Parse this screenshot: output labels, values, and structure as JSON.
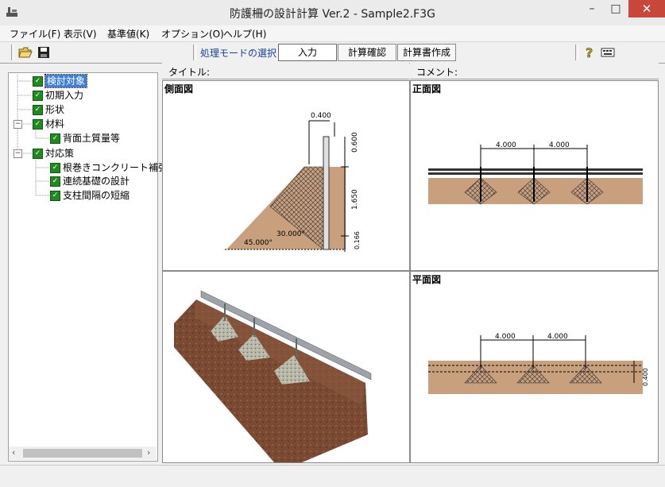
{
  "window": {
    "title": "防護柵の設計計算 Ver.2 - Sample2.F3G",
    "minimize_glyph": "–",
    "maximize_glyph": "□",
    "close_glyph": "✕"
  },
  "menu": [
    {
      "label": "ファイル(F)"
    },
    {
      "label": "表示(V)"
    },
    {
      "label": "基準値(K)"
    },
    {
      "label": "オプション(O)"
    },
    {
      "label": "ヘルプ(H)"
    }
  ],
  "toolbar": {
    "icons": [
      "open-folder-icon",
      "save-disk-icon",
      "help-icon",
      "keyboard-icon"
    ],
    "mode_label": "処理モードの選択",
    "mode_buttons": [
      "入力",
      "計算確認",
      "計算書作成"
    ],
    "active_mode": "入力"
  },
  "tree": {
    "items": [
      {
        "label": "検討対象",
        "checked": true,
        "selected": true
      },
      {
        "label": "初期入力",
        "checked": true
      },
      {
        "label": "形状",
        "checked": true
      },
      {
        "label": "材料",
        "checked": true,
        "expanded": true
      },
      {
        "label": "背面土質量等",
        "checked": true
      },
      {
        "label": "対応策",
        "checked": true,
        "expanded": true
      },
      {
        "label": "根巻きコンクリート補強",
        "checked": true
      },
      {
        "label": "連続基礎の設計",
        "checked": true
      },
      {
        "label": "支柱間隔の短縮",
        "checked": true
      }
    ]
  },
  "headers": {
    "title_label": "タイトル:",
    "comment_label": "コメント:"
  },
  "panels": {
    "side_view": {
      "title": "側面図",
      "dims": {
        "top_width": "0.400",
        "upper_height": "0.600",
        "mid_height": "1.650",
        "low_height": "0.166",
        "angle_slope": "45.000°",
        "angle_face": "30.000°"
      }
    },
    "front_view": {
      "title": "正面図",
      "spans": [
        "4.000",
        "4.000"
      ]
    },
    "view_3d": {
      "title": ""
    },
    "plan_view": {
      "title": "平面図",
      "spans": [
        "4.000",
        "4.000"
      ],
      "side_dim": "0.400"
    }
  },
  "colors": {
    "soil": "#c9a07e",
    "selection": "#3f7fd8",
    "check": "#1f8a1f",
    "mode_text": "#1a3f9e",
    "close_button": "#c7473b"
  }
}
